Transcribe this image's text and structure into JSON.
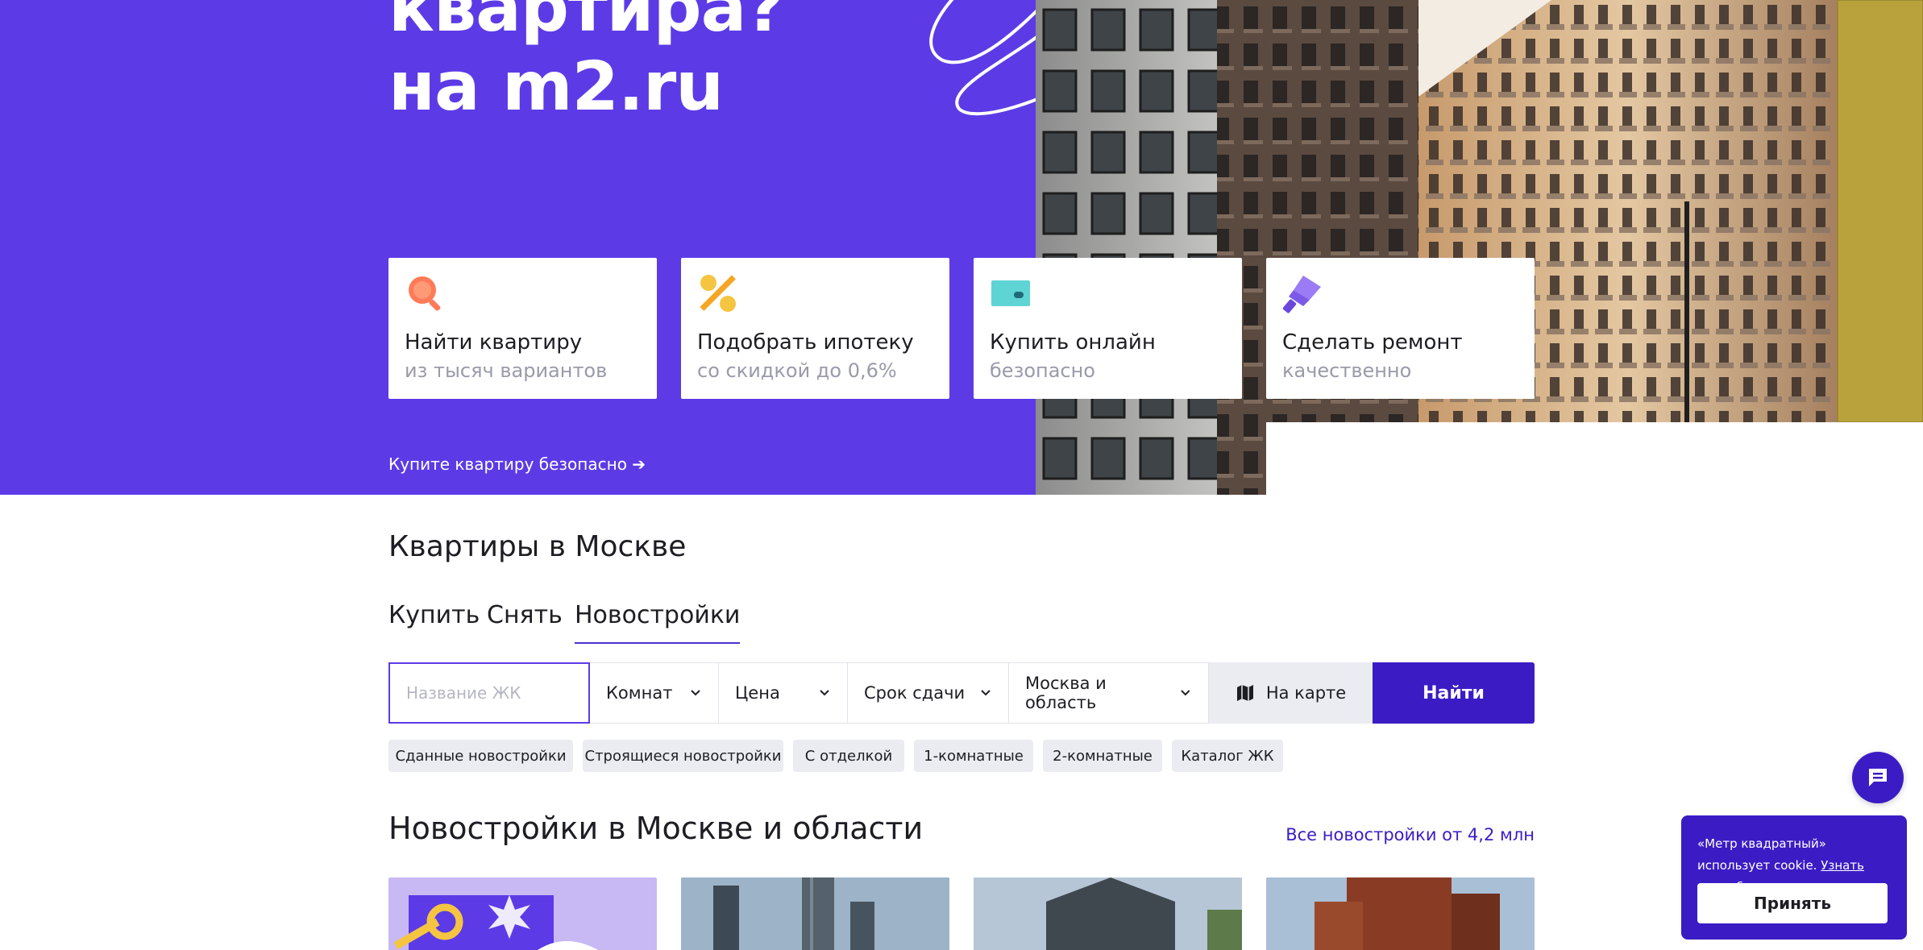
{
  "colors": {
    "brand_purple": "#5c3be6",
    "brand_dark": "#3b1cc4",
    "chip_bg": "#ebebf2",
    "text": "#1d1d23",
    "muted": "#9a9aaa"
  },
  "hero": {
    "title_line1": "квартира?",
    "title_line2": "на m2.ru",
    "cards": [
      {
        "icon": "search-icon",
        "title": "Найти квартиру",
        "subtitle": "из тысяч вариантов"
      },
      {
        "icon": "percent-icon",
        "title": "Подобрать ипотеку",
        "subtitle": "со скидкой до 0,6%"
      },
      {
        "icon": "card-icon",
        "title": "Купить онлайн",
        "subtitle": "безопасно"
      },
      {
        "icon": "paint-roller-icon",
        "title": "Сделать ремонт",
        "subtitle": "качественно"
      }
    ],
    "link": "Купите квартиру безопасно ➔"
  },
  "search": {
    "title": "Квартиры в Москве",
    "tabs": [
      {
        "label": "Купить",
        "active": false
      },
      {
        "label": "Снять",
        "active": false
      },
      {
        "label": "Новостройки",
        "active": true
      }
    ],
    "name_placeholder": "Название ЖК",
    "rooms_label": "Комнат",
    "price_label": "Цена",
    "deadline_label": "Срок сдачи",
    "region_label": "Москва и область",
    "map_label": "На карте",
    "find_label": "Найти",
    "chips": [
      "Сданные новостройки",
      "Строящиеся новостройки",
      "С отделкой",
      "1-комнатные",
      "2-комнатные",
      "Каталог ЖК"
    ]
  },
  "listings": {
    "title": "Новостройки в Москве и области",
    "all_link": "Все новостройки от 4,2 млн"
  },
  "cookie": {
    "text": "«Метр квадратный» использует cookie.",
    "link": "Узнать подробнее.",
    "accept": "Принять"
  }
}
